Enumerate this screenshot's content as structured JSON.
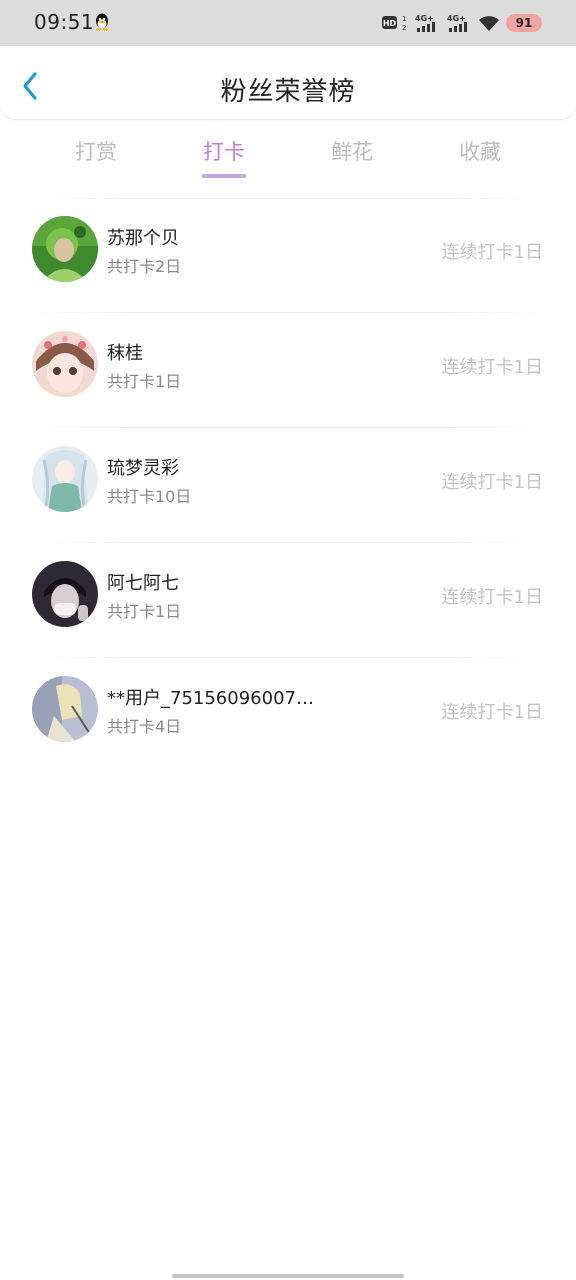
{
  "status_bar": {
    "time": "09:51",
    "hd_label": "HD",
    "hd_sub1": "1",
    "hd_sub2": "2",
    "net1": "4G+",
    "net2": "4G+",
    "battery": "91",
    "battery_color": "#f4a3a3",
    "icons": [
      "qq-icon",
      "hd-icon",
      "signal-icon",
      "signal-icon",
      "wifi-icon",
      "battery-icon"
    ]
  },
  "header": {
    "title": "粉丝荣誉榜",
    "back_icon": "chevron-left-icon",
    "accent": "#1e9be0"
  },
  "tabs": [
    {
      "label": "打赏",
      "active": false
    },
    {
      "label": "打卡",
      "active": true
    },
    {
      "label": "鲜花",
      "active": false
    },
    {
      "label": "收藏",
      "active": false
    }
  ],
  "colors": {
    "tab_active": "#c07fd8",
    "tab_indicator": "#c9a3e3",
    "tab_inactive": "#bdbdbd"
  },
  "fans": [
    {
      "name": "苏那个贝",
      "total": "共打卡2日",
      "streak": "连续打卡1日",
      "avatar": "green-girl-avatar"
    },
    {
      "name": "秣桂",
      "total": "共打卡1日",
      "streak": "连续打卡1日",
      "avatar": "anime-girl-avatar"
    },
    {
      "name": "琉梦灵彩",
      "total": "共打卡10日",
      "streak": "连续打卡1日",
      "avatar": "white-hair-girl-avatar"
    },
    {
      "name": "阿七阿七",
      "total": "共打卡1日",
      "streak": "连续打卡1日",
      "avatar": "masked-boy-avatar"
    },
    {
      "name": "**用户_75156096007…",
      "total": "共打卡4日",
      "streak": "连续打卡1日",
      "avatar": "sketch-avatar"
    }
  ]
}
